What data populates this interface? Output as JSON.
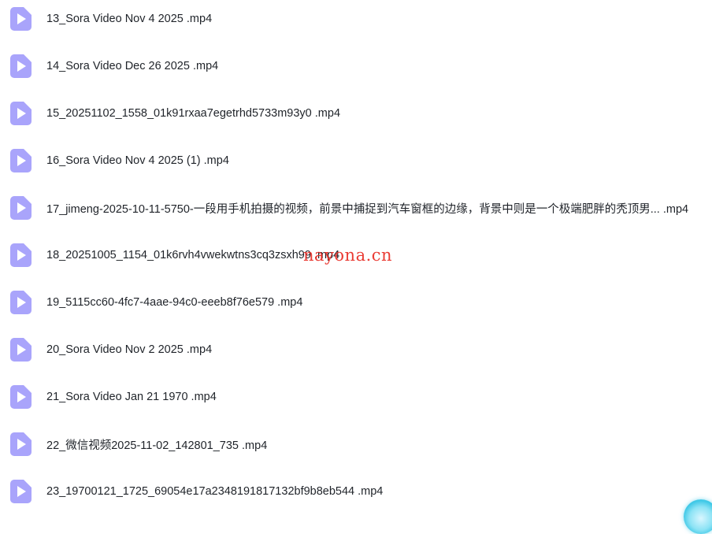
{
  "files": [
    {
      "name": "13_Sora Video Nov 4 2025 .mp4",
      "icon": "video-file-icon"
    },
    {
      "name": "14_Sora Video Dec 26 2025 .mp4",
      "icon": "video-file-icon"
    },
    {
      "name": "15_20251102_1558_01k91rxaa7egetrhd5733m93y0 .mp4",
      "icon": "video-file-icon"
    },
    {
      "name": "16_Sora Video Nov 4 2025 (1) .mp4",
      "icon": "video-file-icon"
    },
    {
      "name": "17_jimeng-2025-10-11-5750-一段用手机拍摄的视频，前景中捕捉到汽车窗框的边缘，背景中则是一个极端肥胖的秃顶男... .mp4",
      "icon": "video-file-icon"
    },
    {
      "name": "18_20251005_1154_01k6rvh4vwekwtns3cq3zsxh99 .mp4",
      "icon": "video-file-icon"
    },
    {
      "name": "19_5115cc60-4fc7-4aae-94c0-eeeb8f76e579 .mp4",
      "icon": "video-file-icon"
    },
    {
      "name": "20_Sora Video Nov 2 2025 .mp4",
      "icon": "video-file-icon"
    },
    {
      "name": "21_Sora Video Jan 21 1970 .mp4",
      "icon": "video-file-icon"
    },
    {
      "name": "22_微信视频2025-11-02_142801_735 .mp4",
      "icon": "video-file-icon"
    },
    {
      "name": "23_19700121_1725_69054e17a2348191817132bf9b8eb544 .mp4",
      "icon": "video-file-icon"
    }
  ],
  "watermark": "nayona.cn",
  "colors": {
    "icon_fill": "#a9a4fb",
    "icon_play": "#ffffff",
    "text": "#1f2329",
    "watermark": "#e8271f"
  }
}
